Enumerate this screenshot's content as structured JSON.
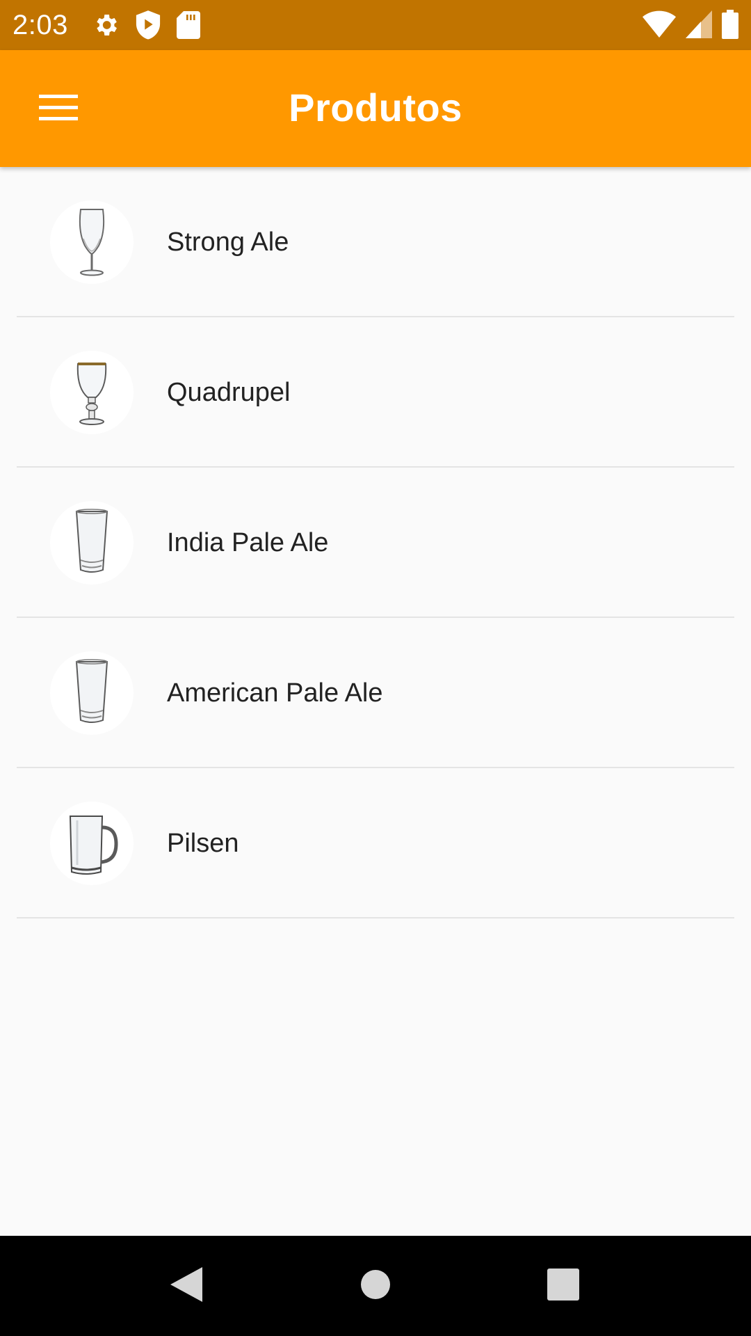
{
  "status_bar": {
    "time": "2:03",
    "left_icons": [
      "gear-icon",
      "shield-play-icon",
      "sd-card-icon"
    ],
    "right_icons": [
      "wifi-icon",
      "cell-signal-icon",
      "battery-icon"
    ]
  },
  "app_bar": {
    "title": "Produtos",
    "menu_icon": "menu-icon",
    "background": "#ff9800",
    "status_background": "#c17400"
  },
  "products": [
    {
      "name": "Strong Ale",
      "image": "tulip-glass"
    },
    {
      "name": "Quadrupel",
      "image": "goblet-glass"
    },
    {
      "name": "India Pale Ale",
      "image": "pint-glass"
    },
    {
      "name": "American Pale Ale",
      "image": "pint-glass"
    },
    {
      "name": "Pilsen",
      "image": "mug-glass"
    }
  ],
  "nav_bar": {
    "buttons": [
      "back-icon",
      "home-icon",
      "recents-icon"
    ]
  }
}
